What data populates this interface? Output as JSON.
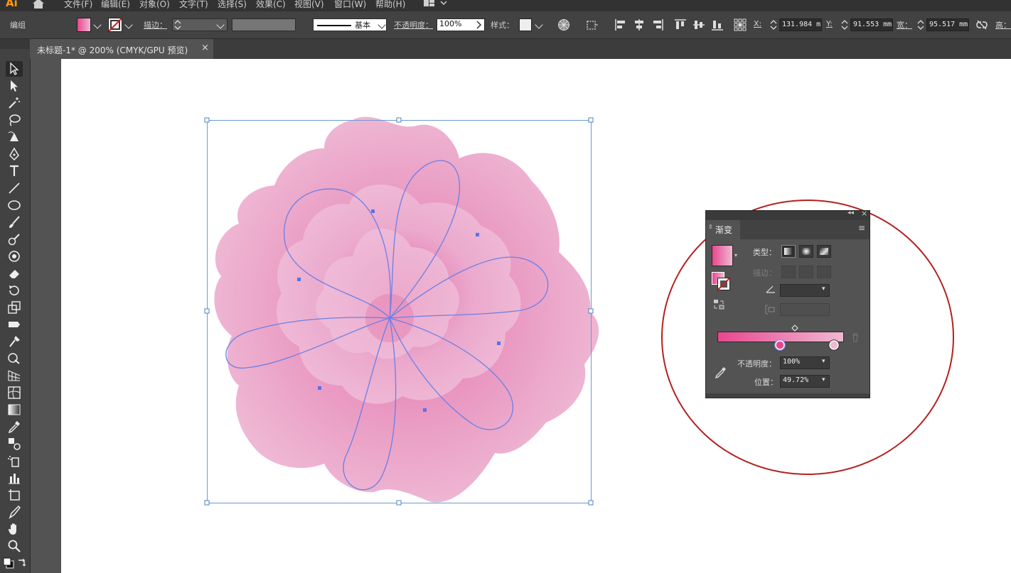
{
  "app": {
    "logo": "Ai"
  },
  "menu": [
    "文件(F)",
    "编辑(E)",
    "对象(O)",
    "文字(T)",
    "选择(S)",
    "效果(C)",
    "视图(V)",
    "窗口(W)",
    "帮助(H)"
  ],
  "control_bar": {
    "mode_label": "编组",
    "stroke_label": "描边：",
    "brush_label": "基本",
    "opacity_label": "不透明度：",
    "opacity_value": "100%",
    "style_label": "样式：",
    "x_label": "X:",
    "x_value": "131.984 m",
    "y_label": "Y:",
    "y_value": "91.553 mm",
    "w_label": "宽：",
    "w_value": "95.517 mm",
    "h_label": "高："
  },
  "document_tab": {
    "title": "未标题-1* @ 200% (CMYK/GPU 预览)",
    "close": "×"
  },
  "gradient_panel": {
    "title": "渐变",
    "type_label": "类型：",
    "stroke_label": "描边：",
    "opacity_label": "不透明度：",
    "opacity_value": "100%",
    "location_label": "位置：",
    "location_value": "49.72%",
    "colors": {
      "start": "#e8478f",
      "end": "#f0b8d2"
    }
  },
  "colors": {
    "petal_light": "#efb9d6",
    "petal_mid": "#e99ac2",
    "petal_deep": "#e0609e",
    "selection": "#6a7fe6",
    "highlight_circle": "#b52020"
  }
}
